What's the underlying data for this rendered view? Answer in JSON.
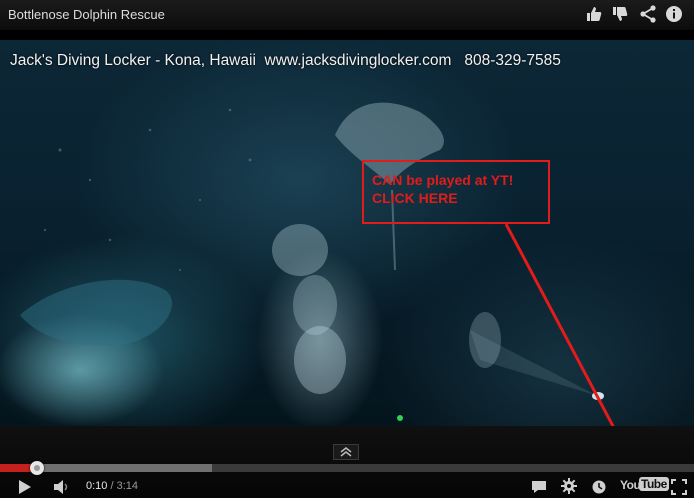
{
  "player": {
    "title": "Bottlenose Dolphin Rescue",
    "top_icons": [
      "thumbs-up-icon",
      "thumbs-down-icon",
      "share-icon",
      "info-icon"
    ],
    "video": {
      "banner": "Jack's Diving Locker - Kona, Hawaii  www.jacksdivinglocker.com   808-329-7585",
      "annotation": "CAN    be played at YT!\nCLICK HERE",
      "annotation_color": "#e21b1b"
    },
    "controls": {
      "current_time": "0:10",
      "separator": " / ",
      "total_time": "3:14",
      "progress_fraction": 0.053,
      "loaded_fraction": 0.305,
      "progress_color": "#c4201d",
      "logo_you": "You",
      "logo_tube": "Tube",
      "icons": [
        "play-icon",
        "volume-icon",
        "captions-icon",
        "settings-gear-icon",
        "watch-later-icon",
        "youtube-logo",
        "fullscreen-icon",
        "expand-chevron-icon"
      ]
    }
  }
}
